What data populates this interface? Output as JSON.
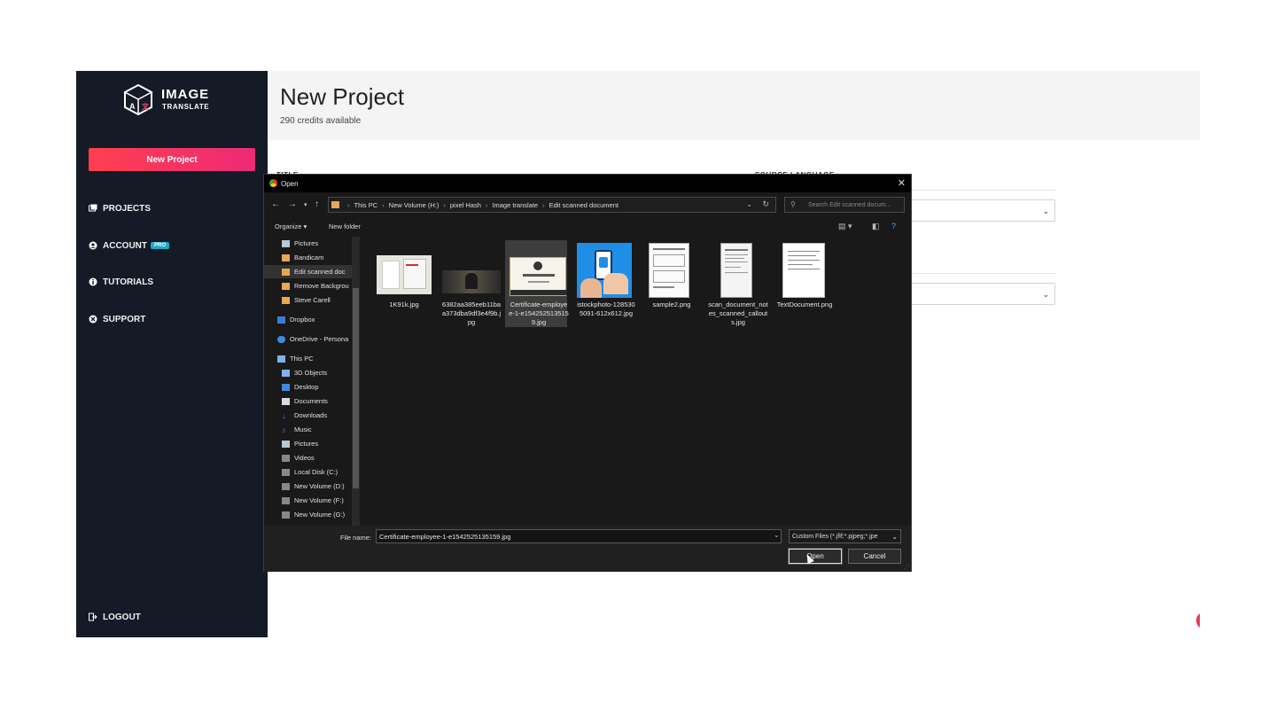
{
  "app": {
    "logo_word1": "IMAGE",
    "logo_word2": "TRANSLATE",
    "new_project_button": "New Project",
    "nav": {
      "projects": "PROJECTS",
      "account": "ACCOUNT",
      "account_badge": "PRO",
      "tutorials": "TUTORIALS",
      "support": "SUPPORT",
      "logout": "LOGOUT"
    },
    "page_title": "New Project",
    "credits": "290 credits available",
    "form": {
      "title_label": "TITLE",
      "source_language_label": "SOURCE LANGUAGE"
    },
    "colors": {
      "sidebar_bg": "#141a26",
      "accent_start": "#ff3f4e",
      "accent_end": "#ec2a77",
      "pro_badge": "#21a7c9"
    }
  },
  "dialog": {
    "title": "Open",
    "breadcrumbs": [
      "This PC",
      "New Volume (H:)",
      "pixel Hash",
      "Image translate",
      "Edit scanned document"
    ],
    "search_placeholder": "Search Edit scanned docum...",
    "toolbar": {
      "organize": "Organize ▾",
      "new_folder": "New folder"
    },
    "tree": [
      {
        "label": "Pictures",
        "icon": "pictures-icon"
      },
      {
        "label": "Bandicam",
        "icon": "folder-icon"
      },
      {
        "label": "Edit scanned doc",
        "icon": "folder-icon",
        "selected": true
      },
      {
        "label": "Remove Backgrou",
        "icon": "folder-icon"
      },
      {
        "label": "Steve Carell",
        "icon": "folder-icon"
      },
      {
        "label": "Dropbox",
        "icon": "dropbox-icon"
      },
      {
        "label": "OneDrive - Persona",
        "icon": "onedrive-icon"
      },
      {
        "label": "This PC",
        "icon": "computer-icon"
      },
      {
        "label": "3D Objects",
        "icon": "cube-icon"
      },
      {
        "label": "Desktop",
        "icon": "desktop-icon"
      },
      {
        "label": "Documents",
        "icon": "documents-icon"
      },
      {
        "label": "Downloads",
        "icon": "download-icon"
      },
      {
        "label": "Music",
        "icon": "music-icon"
      },
      {
        "label": "Pictures",
        "icon": "pictures-icon"
      },
      {
        "label": "Videos",
        "icon": "videos-icon"
      },
      {
        "label": "Local Disk (C:)",
        "icon": "drive-icon"
      },
      {
        "label": "New Volume (D:)",
        "icon": "drive-icon"
      },
      {
        "label": "New Volume (F:)",
        "icon": "drive-icon"
      },
      {
        "label": "New Volume (G:)",
        "icon": "drive-icon"
      }
    ],
    "files": [
      {
        "name": "1K91k.jpg",
        "kind": "photo-doc"
      },
      {
        "name": "6382aa385eeb11baa373dba9df3e4f9b.jpg",
        "kind": "dark-photo"
      },
      {
        "name": "Certificate-employee-1-e1542525135159.jpg",
        "kind": "certificate",
        "selected": true
      },
      {
        "name": "istockphoto-1285305091-612x612.jpg",
        "kind": "phone-photo"
      },
      {
        "name": "sample2.png",
        "kind": "form-doc"
      },
      {
        "name": "scan_document_notes_scanned_callouts.jpg",
        "kind": "scan-doc"
      },
      {
        "name": "TextDocument.png",
        "kind": "text-doc"
      }
    ],
    "file_name_label": "File name:",
    "file_name_value": "Certificate-employee-1-e1542525135159.jpg",
    "filter_value": "Custom Files (*.jfif;*.pjpeg;*.jpe",
    "open_button": "Open",
    "cancel_button": "Cancel"
  }
}
